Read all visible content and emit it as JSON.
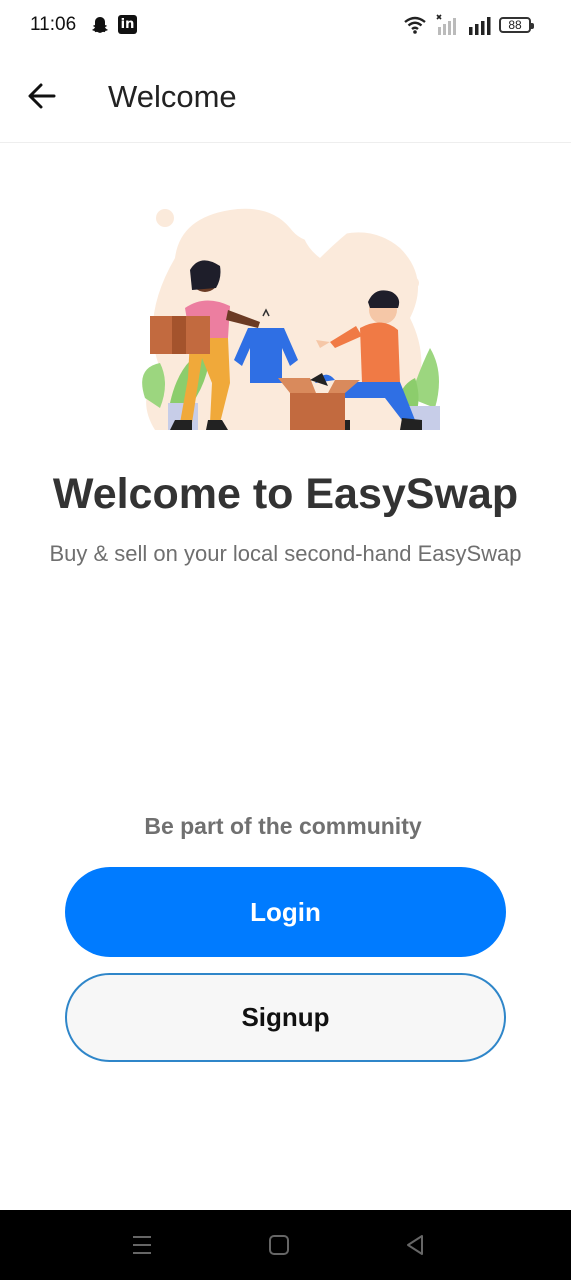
{
  "status_bar": {
    "time": "11:06",
    "battery": "88",
    "icons": [
      "snapchat-icon",
      "linkedin-icon",
      "wifi-icon",
      "signal-icon",
      "battery-icon"
    ]
  },
  "app_bar": {
    "title": "Welcome",
    "back_icon": "arrow-left-icon"
  },
  "hero": {
    "illustration": "people-swapping-clothes-illustration"
  },
  "content": {
    "title": "Welcome to EasySwap",
    "subtitle": "Buy & sell on your local second-hand EasySwap"
  },
  "actions": {
    "community_text": "Be part of the community",
    "login_label": "Login",
    "signup_label": "Signup"
  },
  "nav_bar": {
    "icons": [
      "menu-icon",
      "home-icon",
      "back-triangle-icon"
    ]
  },
  "colors": {
    "primary": "#007bff",
    "signup_border": "#2f86c9",
    "title": "#333333",
    "subtitle": "#6f6f6f"
  }
}
